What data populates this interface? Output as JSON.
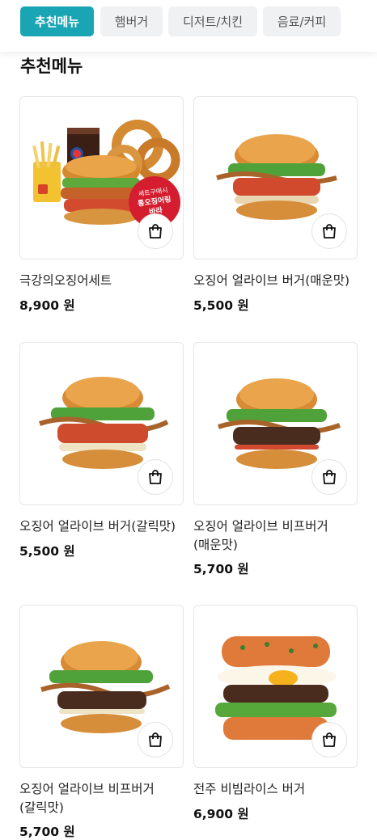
{
  "tabs": [
    {
      "label": "추천메뉴",
      "active": true
    },
    {
      "label": "햄버거",
      "active": false
    },
    {
      "label": "디저트/치킨",
      "active": false
    },
    {
      "label": "음료/커피",
      "active": false
    }
  ],
  "section_title": "추천메뉴",
  "products": [
    {
      "name": "극강의오징어세트",
      "price": "8,900 원",
      "badge": {
        "line1": "세트구매시",
        "line2": "통오징어링",
        "line3": "바라"
      }
    },
    {
      "name": "오징어 얼라이브 버거(매운맛)",
      "price": "5,500 원"
    },
    {
      "name": "오징어 얼라이브 버거(갈릭맛)",
      "price": "5,500 원"
    },
    {
      "name": "오징어 얼라이브 비프버거\n(매운맛)",
      "price": "5,700 원"
    },
    {
      "name": "오징어 얼라이브 비프버거\n(갈릭맛)",
      "price": "5,700 원"
    },
    {
      "name": "전주 비빔라이스 버거",
      "price": "6,900 원"
    }
  ],
  "colors": {
    "accent": "#1aa5b5",
    "tab_inactive_bg": "#f0f1f3",
    "badge_red": "#d41e2f"
  },
  "icons": {
    "cart": "shopping-bag-icon"
  }
}
